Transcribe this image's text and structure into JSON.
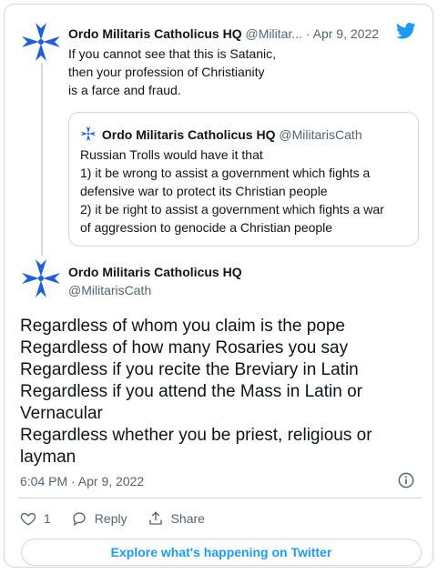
{
  "tweet1": {
    "name": "Ordo Militaris Catholicus HQ",
    "handle": "@Militar...",
    "separator": "·",
    "date": "Apr 9, 2022",
    "text_lines": [
      "If you cannot see that this is Satanic,",
      "then your profession of Christianity",
      "is a farce and fraud."
    ]
  },
  "quote": {
    "name": "Ordo Militaris Catholicus HQ",
    "handle": "@MilitarisCath",
    "text_lines": [
      "Russian Trolls would have it that",
      "1) it be wrong to assist a government which fights a",
      "defensive war to protect its Christian people",
      "2) it be right to assist a government which fights a war",
      "of aggression to genocide a Christian people"
    ]
  },
  "tweet2": {
    "name": "Ordo Militaris Catholicus HQ",
    "handle": "@MilitarisCath",
    "text_lines": [
      "Regardless of whom you claim is the pope",
      "Regardless of how many Rosaries you say",
      "Regardless if you recite the Breviary in Latin",
      "Regardless if you attend the Mass in Latin or",
      "Vernacular",
      "Regardless whether you be priest, religious or",
      "layman"
    ],
    "timestamp": "6:04 PM · Apr 9, 2022"
  },
  "actions": {
    "like_count": "1",
    "reply_label": "Reply",
    "share_label": "Share"
  },
  "explore_label": "Explore what's happening on Twitter",
  "colors": {
    "accent": "#1d9bf0",
    "cross": "#1d5fd6",
    "border": "#cfd9de",
    "secondary_text": "#536471"
  },
  "icons": [
    "cross-avatar-icon",
    "twitter-bird-icon",
    "info-icon",
    "heart-icon",
    "reply-icon",
    "share-icon"
  ]
}
